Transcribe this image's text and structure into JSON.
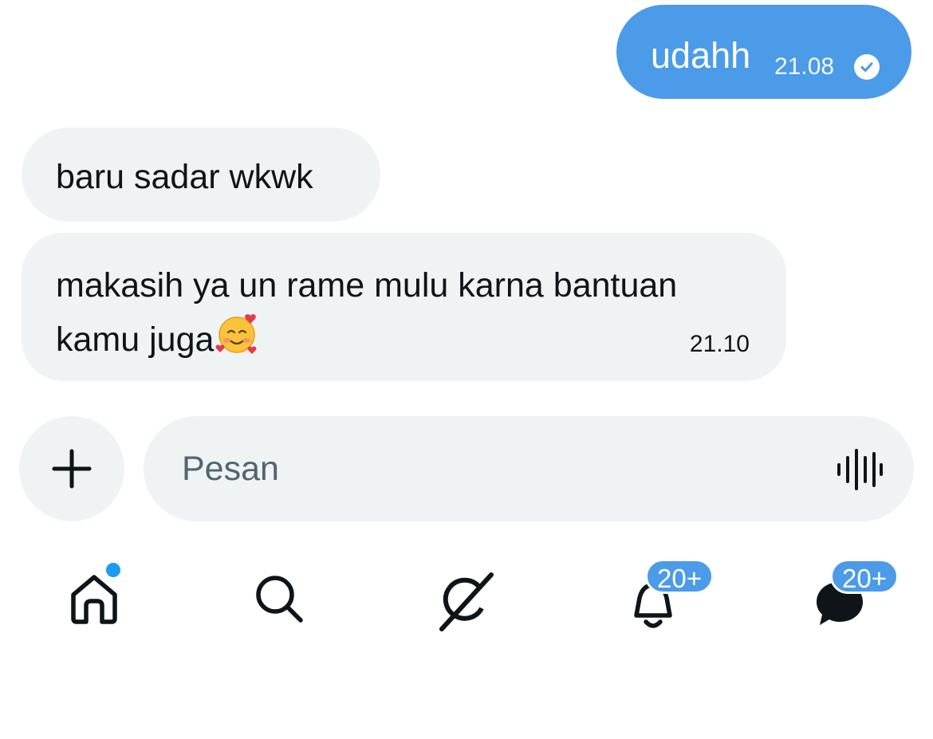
{
  "messages": [
    {
      "direction": "sent",
      "text": "udahh",
      "time": "21.08",
      "status": "read-check-icon"
    },
    {
      "direction": "received",
      "text": "baru sadar wkwk"
    },
    {
      "direction": "received",
      "text": "makasih ya un rame mulu karna bantuan kamu juga",
      "emoji": "smiling-face-with-hearts",
      "time": "21.10"
    }
  ],
  "composer": {
    "placeholder": "Pesan",
    "add_icon": "plus-icon",
    "voice_icon": "voice-waveform-icon"
  },
  "bottom_nav": {
    "items": [
      {
        "name": "home",
        "icon": "home-icon",
        "has_dot": true
      },
      {
        "name": "search",
        "icon": "search-icon"
      },
      {
        "name": "grok",
        "icon": "grok-icon"
      },
      {
        "name": "notifications",
        "icon": "bell-icon",
        "badge": "20+"
      },
      {
        "name": "messages",
        "icon": "chat-bubble-icon",
        "badge": "20+"
      }
    ]
  },
  "colors": {
    "sent_bubble": "#4b9be8",
    "received_bubble": "#eff3f4",
    "accent_dot": "#1d9bf0",
    "text": "#0f1419",
    "placeholder": "#536471"
  }
}
